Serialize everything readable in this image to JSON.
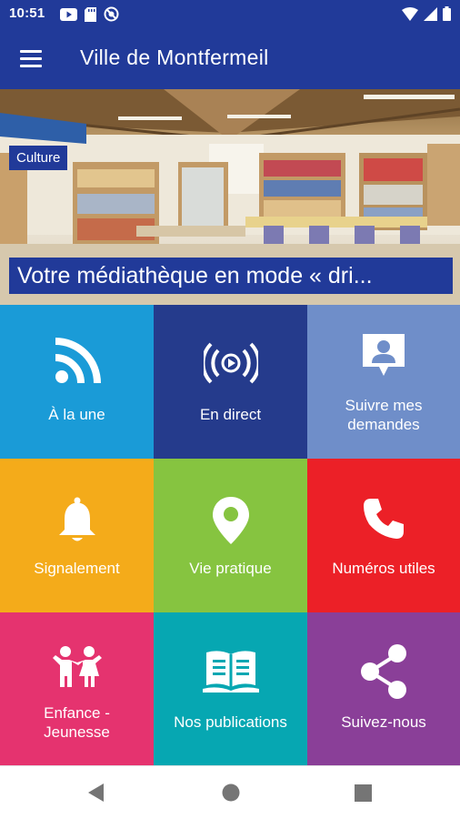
{
  "status_bar": {
    "time": "10:51",
    "left_icons": [
      "youtube-icon",
      "sd-card-icon",
      "do-not-disturb-icon"
    ],
    "right_icons": [
      "wifi-icon",
      "signal-icon",
      "battery-icon"
    ]
  },
  "app_bar": {
    "title": "Ville de Montfermeil",
    "menu_icon": "hamburger-menu-icon"
  },
  "hero": {
    "tag": "Culture",
    "caption": "Votre médiathèque en mode « dri..."
  },
  "colors": {
    "primary": "#213a99",
    "tile_a_la_une": "#1a9bd7",
    "tile_en_direct": "#253b8c",
    "tile_suivre": "#6f8ec9",
    "tile_signalement": "#f4ab1a",
    "tile_vie_pratique": "#86c440",
    "tile_numeros": "#ec2027",
    "tile_enfance": "#e5336f",
    "tile_publications": "#06a7b2",
    "tile_suivez": "#8a3f98"
  },
  "tiles": [
    {
      "label": "À la une",
      "icon": "rss-icon"
    },
    {
      "label": "En direct",
      "icon": "live-broadcast-icon"
    },
    {
      "label_line1": "Suivre mes",
      "label_line2": "demandes",
      "icon": "user-message-icon"
    },
    {
      "label": "Signalement",
      "icon": "bell-icon"
    },
    {
      "label": "Vie pratique",
      "icon": "map-pin-icon"
    },
    {
      "label": "Numéros utiles",
      "icon": "phone-icon"
    },
    {
      "label_line1": "Enfance -",
      "label_line2": "Jeunesse",
      "icon": "children-icon"
    },
    {
      "label": "Nos publications",
      "icon": "book-icon"
    },
    {
      "label": "Suivez-nous",
      "icon": "share-icon"
    }
  ],
  "nav_bar": {
    "buttons": [
      "back-icon",
      "home-icon",
      "recents-icon"
    ]
  }
}
